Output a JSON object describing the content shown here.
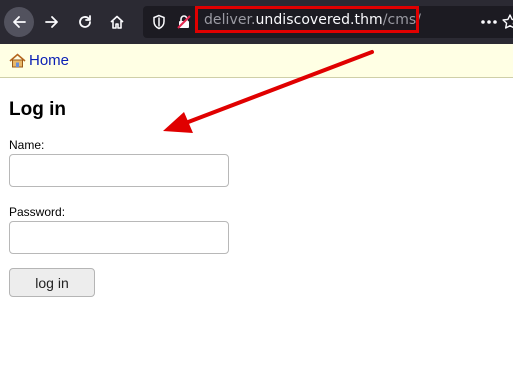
{
  "browser": {
    "url": {
      "subdomain": "deliver.",
      "domain": "undiscovered.thm",
      "path": "/cms/"
    },
    "icons": [
      "back-icon",
      "forward-icon",
      "reload-icon",
      "home-icon",
      "shield-icon",
      "insecure-lock-icon",
      "more-icon",
      "bookmark-star-icon"
    ]
  },
  "breadcrumb": {
    "home_label": "Home"
  },
  "login": {
    "title": "Log in",
    "name_label": "Name:",
    "name_value": "",
    "password_label": "Password:",
    "password_value": "",
    "submit_label": "log in"
  },
  "annotation": {
    "highlight_color": "#e00000",
    "arrow_color": "#e00000"
  }
}
